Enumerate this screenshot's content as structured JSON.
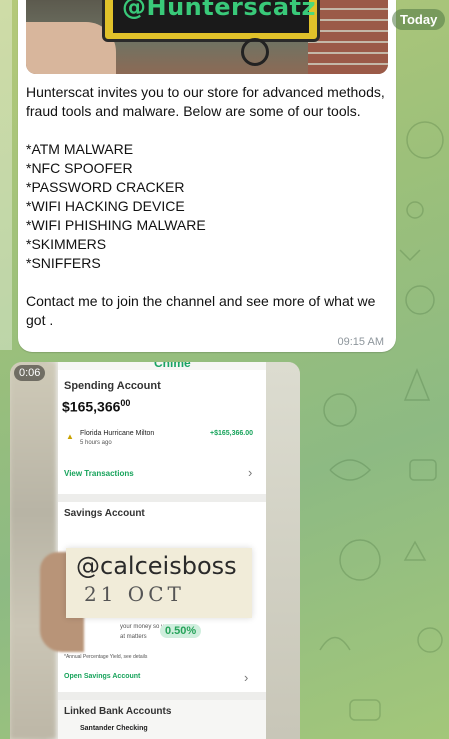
{
  "date_badge": "Today",
  "message": {
    "photo_watermark": "@Hunterscatz",
    "intro": "Hunterscat invites you to our store for advanced methods,  fraud tools and malware. Below are some of our tools.",
    "tools": [
      "*ATM MALWARE",
      "*NFC SPOOFER",
      "*PASSWORD CRACKER",
      "*WIFI HACKING DEVICE",
      "*WIFI PHISHING MALWARE",
      "*SKIMMERS",
      "*SNIFFERS"
    ],
    "outro": "Contact me to join the channel and see more of what we got .",
    "time": "09:15 AM"
  },
  "video": {
    "duration": "0:06",
    "app_header": "Chime",
    "spending_label": "Spending Account",
    "balance_main": "$165,366",
    "balance_cents": "00",
    "tx_name": "Florida Hurricane Milton",
    "tx_time": "5 hours ago",
    "tx_amount": "+$165,366.00",
    "view_tx": "View Transactions",
    "savings_label": "Savings Account",
    "note_handle": "@calceisboss",
    "note_date": "21 OCT",
    "money_text": "your money so you can",
    "matters_text": "at matters",
    "apy": "0.50%",
    "apy_note": "*Annual Percentage Yield, see details",
    "open_savings": "Open Savings Account",
    "linked_label": "Linked Bank Accounts",
    "linked_item": "Santander Checking"
  }
}
